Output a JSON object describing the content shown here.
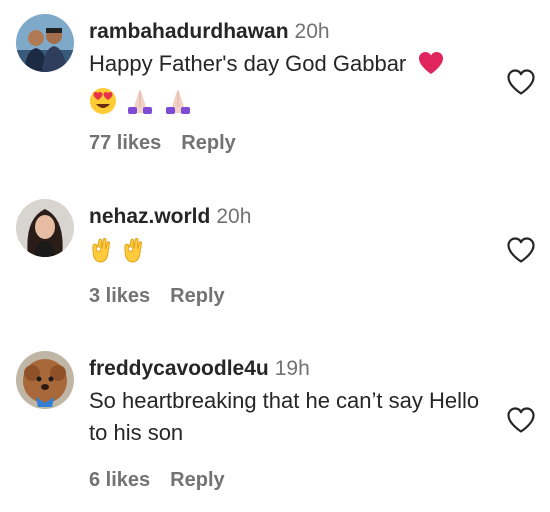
{
  "comments": [
    {
      "username": "rambahadurdhawan",
      "time": "20h",
      "text": "Happy Father's day God Gabbar",
      "likes": "77 likes",
      "reply": "Reply"
    },
    {
      "username": "nehaz.world",
      "time": "20h",
      "text": "",
      "likes": "3 likes",
      "reply": "Reply"
    },
    {
      "username": "freddycavoodle4u",
      "time": "19h",
      "text": "So heartbreaking that he can’t say Hello to his son",
      "likes": "6 likes",
      "reply": "Reply"
    }
  ],
  "icons": {
    "like": "heart-outline-icon",
    "red_heart": "red-heart-emoji",
    "heart_eyes": "heart-eyes-emoji",
    "praying_hands": "praying-hands-emoji",
    "ok_hand": "ok-hand-emoji"
  },
  "colors": {
    "username": "#262626",
    "secondary": "#737373",
    "heart_red": "#e0245e"
  }
}
